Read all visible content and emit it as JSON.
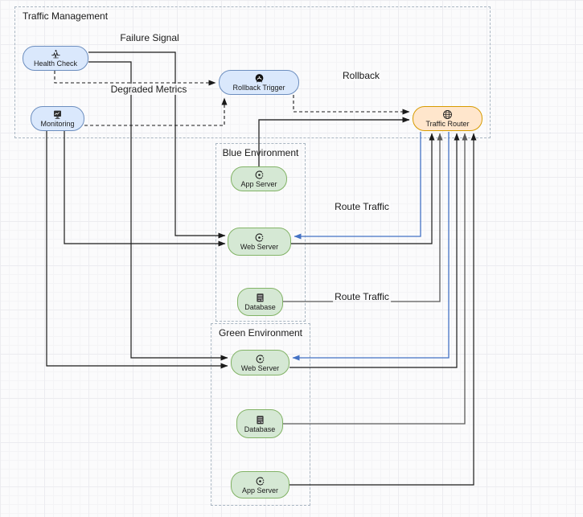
{
  "containers": {
    "traffic_management": {
      "label": "Traffic Management"
    },
    "blue_environment": {
      "label": "Blue Environment"
    },
    "green_environment": {
      "label": "Green Environment"
    }
  },
  "nodes": {
    "health_check": {
      "label": "Health Check",
      "icon": "health-check-icon"
    },
    "monitoring": {
      "label": "Monitoring",
      "icon": "monitoring-icon"
    },
    "rollback_trigger": {
      "label": "Rollback Trigger",
      "icon": "alarm-icon"
    },
    "traffic_router": {
      "label": "Traffic Router",
      "icon": "globe-icon"
    },
    "blue_app_server": {
      "label": "App Server",
      "icon": "service-icon"
    },
    "blue_web_server": {
      "label": "Web Server",
      "icon": "service-icon"
    },
    "blue_database": {
      "label": "Database",
      "icon": "database-icon"
    },
    "green_web_server": {
      "label": "Web Server",
      "icon": "service-icon"
    },
    "green_database": {
      "label": "Database",
      "icon": "database-icon"
    },
    "green_app_server": {
      "label": "App Server",
      "icon": "service-icon"
    }
  },
  "edge_labels": {
    "failure_signal": "Failure Signal",
    "degraded_metrics": "Degraded Metrics",
    "rollback": "Rollback",
    "route_traffic_blue": "Route Traffic",
    "route_traffic_green": "Route Traffic"
  },
  "edges": [
    {
      "from": "health_check",
      "to": "blue_web_server",
      "style": "solid"
    },
    {
      "from": "health_check",
      "to": "green_web_server",
      "style": "solid"
    },
    {
      "from": "monitoring",
      "to": "blue_web_server",
      "style": "solid"
    },
    {
      "from": "monitoring",
      "to": "green_web_server",
      "style": "solid"
    },
    {
      "from": "health_check",
      "to": "rollback_trigger",
      "style": "dashed"
    },
    {
      "from": "monitoring",
      "to": "rollback_trigger",
      "style": "dashed"
    },
    {
      "from": "rollback_trigger",
      "to": "traffic_router",
      "style": "dashed",
      "label": "Rollback"
    },
    {
      "from": "blue_app_server",
      "to": "traffic_router",
      "style": "solid"
    },
    {
      "from": "blue_web_server",
      "to": "traffic_router",
      "style": "solid"
    },
    {
      "from": "blue_database",
      "to": "traffic_router",
      "style": "solid"
    },
    {
      "from": "green_web_server",
      "to": "traffic_router",
      "style": "solid"
    },
    {
      "from": "green_database",
      "to": "traffic_router",
      "style": "solid"
    },
    {
      "from": "green_app_server",
      "to": "traffic_router",
      "style": "solid"
    },
    {
      "from": "traffic_router",
      "to": "blue_web_server",
      "style": "solid-blue",
      "label": "Route Traffic"
    },
    {
      "from": "traffic_router",
      "to": "green_web_server",
      "style": "solid-blue",
      "label": "Route Traffic"
    }
  ],
  "colors": {
    "node_blue_fill": "#dae8fc",
    "node_blue_stroke": "#6c8ebf",
    "node_green_fill": "#d5e8d4",
    "node_green_stroke": "#82b366",
    "node_orange_fill": "#ffe6cc",
    "node_orange_stroke": "#d79b00",
    "edge_black": "#1a1a1a",
    "edge_gray": "#595959",
    "edge_blue": "#4472c4",
    "container_border": "#a9b6c2"
  }
}
